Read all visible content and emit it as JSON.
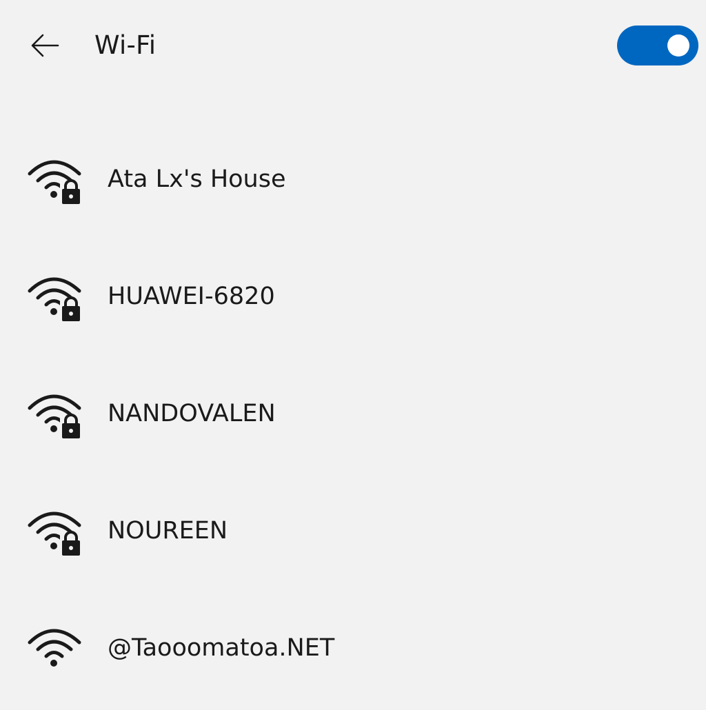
{
  "header": {
    "back_icon": "back-arrow-icon",
    "title": "Wi-Fi",
    "toggle": {
      "state": "on",
      "color": "#0067c0"
    }
  },
  "networks": [
    {
      "name": "Ata Lx's House",
      "icon": "wifi-secured-icon",
      "secured": true
    },
    {
      "name": "HUAWEI-6820",
      "icon": "wifi-secured-icon",
      "secured": true
    },
    {
      "name": "NANDOVALEN",
      "icon": "wifi-secured-icon",
      "secured": true
    },
    {
      "name": "NOUREEN",
      "icon": "wifi-secured-icon",
      "secured": true
    },
    {
      "name": "@Taooomatoa.NET",
      "icon": "wifi-icon",
      "secured": false
    }
  ]
}
